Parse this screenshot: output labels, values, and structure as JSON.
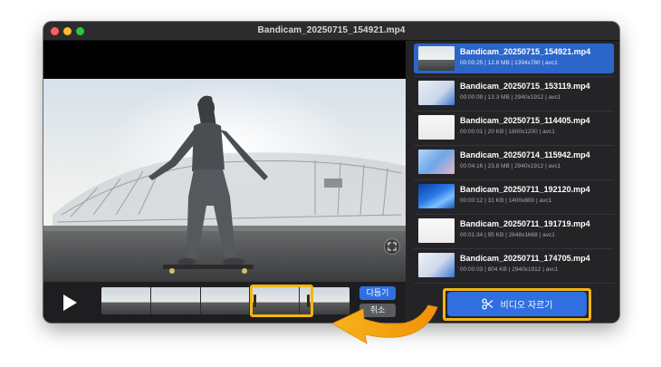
{
  "window": {
    "title": "Bandicam_20250715_154921.mp4"
  },
  "player": {
    "play_icon": "play-icon",
    "expand_icon": "expand-icon",
    "done_label": "다듬기",
    "cancel_label": "취소",
    "trim_handle_color": "#f4b515"
  },
  "files": [
    {
      "name": "Bandicam_20250715_154921.mp4",
      "meta": "00:00:25 | 12.8 MB | 1394x780 | avc1",
      "selected": true,
      "thumb": "video-frame"
    },
    {
      "name": "Bandicam_20250715_153119.mp4",
      "meta": "00:00:09 | 13.3 MB | 2940x1912 | avc1",
      "selected": false,
      "thumb": "desktop-screenshot"
    },
    {
      "name": "Bandicam_20250715_114405.mp4",
      "meta": "00:00:01 | 20 KB | 1600x1200 | avc1",
      "selected": false,
      "thumb": "document-screenshot"
    },
    {
      "name": "Bandicam_20250714_115942.mp4",
      "meta": "00:04:16 | 23.8 MB | 2940x1912 | avc1",
      "selected": false,
      "thumb": "desktop-screenshot"
    },
    {
      "name": "Bandicam_20250711_192120.mp4",
      "meta": "00:00:12 | 31 KB | 1400x800 | avc1",
      "selected": false,
      "thumb": "blue-wallpaper"
    },
    {
      "name": "Bandicam_20250711_191719.mp4",
      "meta": "00:01:34 | 95 KB | 2648x1668 | avc1",
      "selected": false,
      "thumb": "document-screenshot"
    },
    {
      "name": "Bandicam_20250711_174705.mp4",
      "meta": "00:00:03 | 804 KB | 2940x1912 | avc1",
      "selected": false,
      "thumb": "desktop-screenshot"
    }
  ],
  "cut_button": {
    "label": "비디오 자르기",
    "icon": "scissors-icon"
  },
  "colors": {
    "accent": "#2f6fe0",
    "selected_row": "#2d66c9",
    "highlight": "#f4b515",
    "arrow": "#f2a20c"
  }
}
